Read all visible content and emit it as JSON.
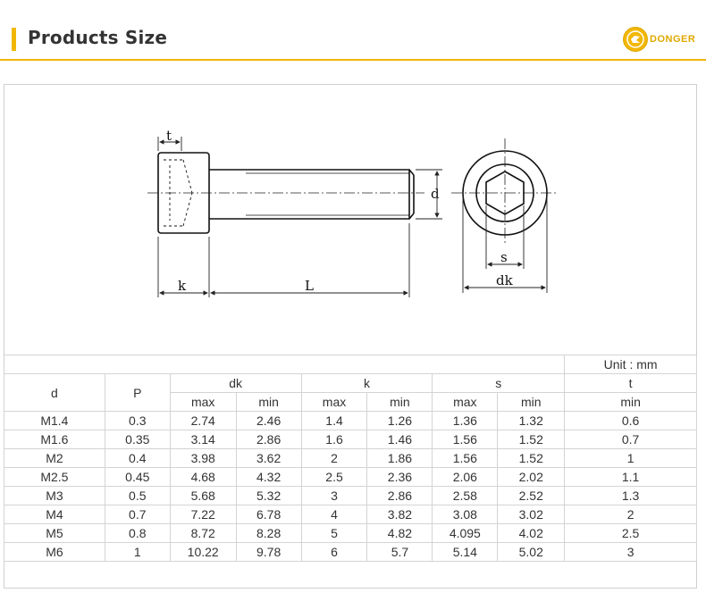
{
  "header": {
    "title": "Products Size",
    "logo_text": "DONGER",
    "logo_icon": "donger-logo-icon"
  },
  "drawing": {
    "labels": {
      "t": "t",
      "d": "d",
      "k": "k",
      "L": "L",
      "s": "s",
      "dk": "dk"
    }
  },
  "table": {
    "unit": "Unit : mm",
    "headers": {
      "d": "d",
      "P": "P",
      "dk": "dk",
      "k": "k",
      "s": "s",
      "t": "t",
      "max": "max",
      "min": "min"
    },
    "rows": [
      [
        "M1.4",
        "0.3",
        "2.74",
        "2.46",
        "1.4",
        "1.26",
        "1.36",
        "1.32",
        "0.6"
      ],
      [
        "M1.6",
        "0.35",
        "3.14",
        "2.86",
        "1.6",
        "1.46",
        "1.56",
        "1.52",
        "0.7"
      ],
      [
        "M2",
        "0.4",
        "3.98",
        "3.62",
        "2",
        "1.86",
        "1.56",
        "1.52",
        "1"
      ],
      [
        "M2.5",
        "0.45",
        "4.68",
        "4.32",
        "2.5",
        "2.36",
        "2.06",
        "2.02",
        "1.1"
      ],
      [
        "M3",
        "0.5",
        "5.68",
        "5.32",
        "3",
        "2.86",
        "2.58",
        "2.52",
        "1.3"
      ],
      [
        "M4",
        "0.7",
        "7.22",
        "6.78",
        "4",
        "3.82",
        "3.08",
        "3.02",
        "2"
      ],
      [
        "M5",
        "0.8",
        "8.72",
        "8.28",
        "5",
        "4.82",
        "4.095",
        "4.02",
        "2.5"
      ],
      [
        "M6",
        "1",
        "10.22",
        "9.78",
        "6",
        "5.7",
        "5.14",
        "5.02",
        "3"
      ]
    ]
  }
}
